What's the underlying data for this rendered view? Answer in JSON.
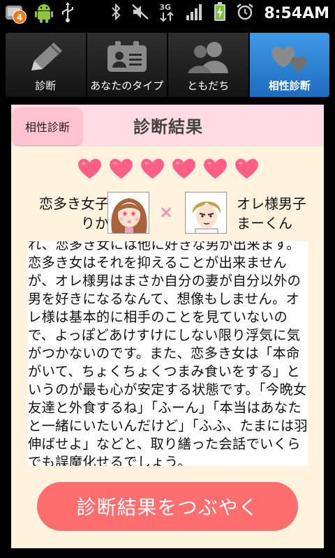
{
  "status_bar": {
    "notification_count": "4",
    "time": "8:54AM",
    "network_label": "3G",
    "icons": [
      "notification-badge-icon",
      "android-robot-icon",
      "usb-icon",
      "bluetooth-icon",
      "mute-icon",
      "3g-data-icon",
      "signal-icon",
      "battery-charging-icon",
      "alarm-icon"
    ]
  },
  "tabs": [
    {
      "label": "診断",
      "icon": "pencil-icon",
      "active": false
    },
    {
      "label": "あなたのタイプ",
      "icon": "id-card-icon",
      "active": false
    },
    {
      "label": "ともだち",
      "icon": "friends-icon",
      "active": false
    },
    {
      "label": "相性診断",
      "icon": "hearts-icon",
      "active": true
    }
  ],
  "header": {
    "button_label": "相性診断",
    "title": "診断結果"
  },
  "hearts": {
    "count": 6,
    "color": "#ff5f86"
  },
  "match": {
    "left_name": [
      "恋多き女子",
      "りか"
    ],
    "right_name": [
      "オレ様男子",
      "まーくん"
    ],
    "separator": "×"
  },
  "result_text": "れ、恋多き女には他に好きな男が出来ます。恋多き女はそれを抑えることが出来ませんが、オレ様男はまさか自分の妻が自分以外の男を好きになるなんて、想像もしません。オレ様は基本的に相手のことを見ていないので、よっぽどあけすけにしない限り浮気に気がつかないのです。また、恋多き女は「本命がいて、ちょくちょくつまみ食いをする」というのが最も心が安定する状態です。「今晩女友達と外食するね」「ふーん」「本当はあなたと一緒にいたいんだけど」「ふふ、たまには羽伸ばせよ」などと、取り繕った会話でいくらでも誤魔化せるでしょう。",
  "tweet_button": {
    "label": "診断結果をつぶやく"
  },
  "colors": {
    "accent_blue": "#2f86d8",
    "pink_header": "#ffdbe3",
    "panel": "#fff3de",
    "button": "#ff6e6e"
  }
}
